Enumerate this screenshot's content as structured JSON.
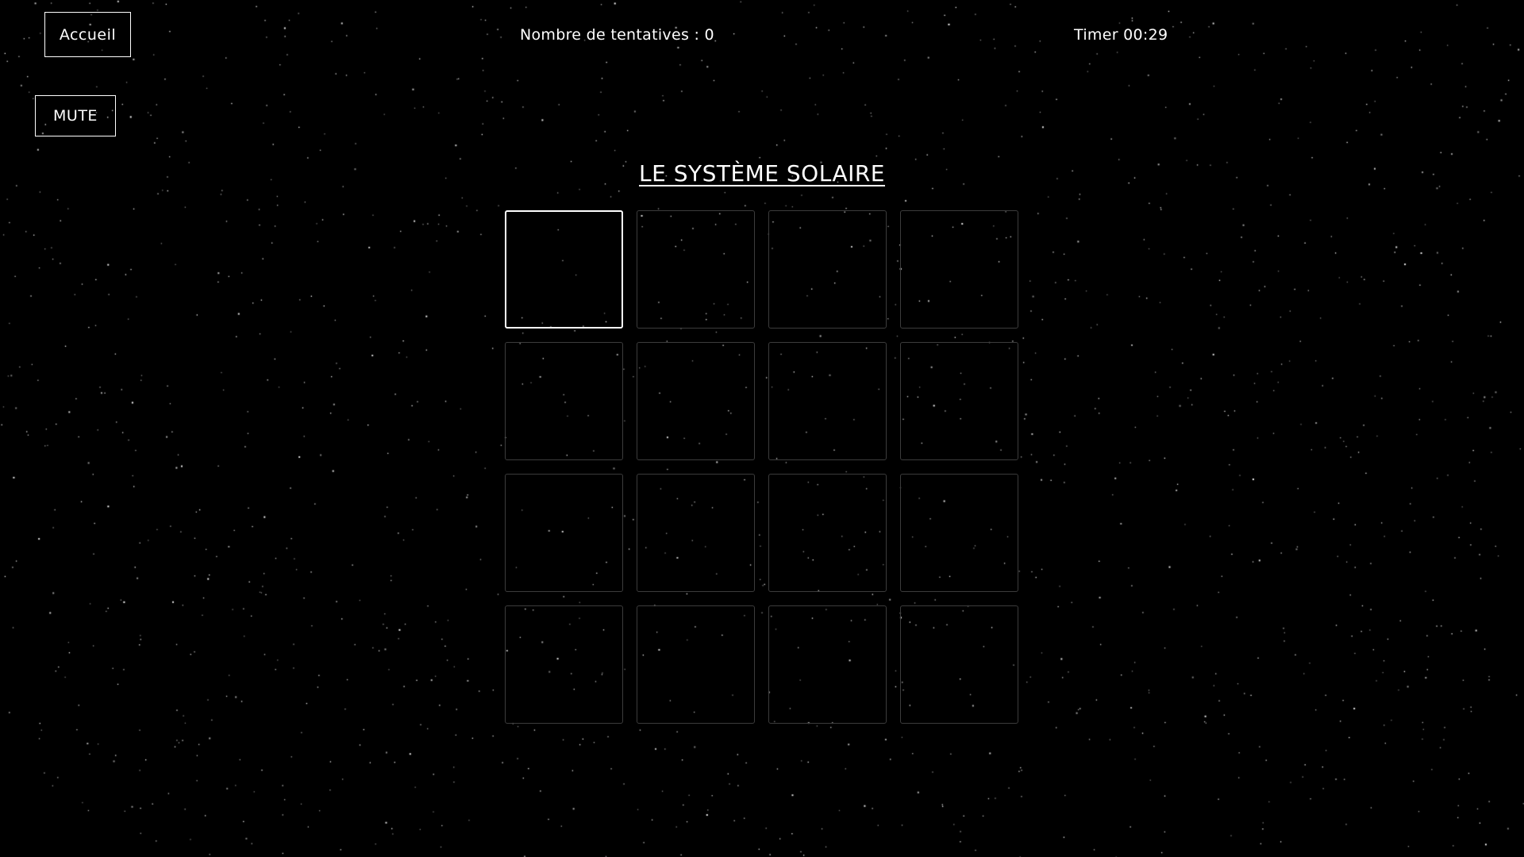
{
  "header": {
    "home_label": "Accueil",
    "attempts_label": "Nombre de tentatives : 0",
    "timer_label": "Timer 00:29"
  },
  "controls": {
    "mute_label": "MUTE"
  },
  "game": {
    "title": "LE SYSTÈME SOLAIRE",
    "rows": 4,
    "columns": 4,
    "selected_card": 1,
    "cards_face_down": 16
  },
  "colors": {
    "background": "#000000",
    "text": "#ffffff",
    "card_border": "#3c3c3c",
    "card_border_active": "#ffffff"
  }
}
